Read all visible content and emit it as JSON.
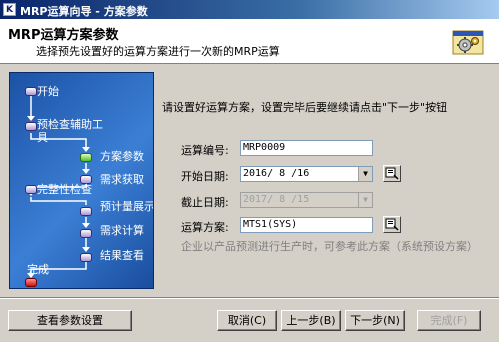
{
  "window": {
    "title": "MRP运算向导 - 方案参数",
    "icon": "app-logo-icon",
    "icon_text": "K"
  },
  "header": {
    "title": "MRP运算方案参数",
    "subtitle": "选择预先设置好的运算方案进行一次新的MRP运算",
    "icon": "gear-settings-icon"
  },
  "steps": [
    {
      "label": "开始",
      "state": "done"
    },
    {
      "label": "预检查辅助工具",
      "state": "done"
    },
    {
      "label": "方案参数",
      "state": "current"
    },
    {
      "label": "需求获取",
      "state": "pending"
    },
    {
      "label": "完整性检查",
      "state": "pending"
    },
    {
      "label": "预计量展示",
      "state": "pending"
    },
    {
      "label": "需求计算",
      "state": "pending"
    },
    {
      "label": "结果查看",
      "state": "pending"
    },
    {
      "label": "完成",
      "state": "end"
    }
  ],
  "form": {
    "instruction": "请设置好运算方案，设置完毕后要继续请点击\"下一步\"按钮",
    "calc_no": {
      "label": "运算编号:",
      "value": "MRP0009"
    },
    "start_date": {
      "label": "开始日期:",
      "value": "2016/ 8 /16"
    },
    "end_date": {
      "label": "截止日期:",
      "value": "2017/ 8 /15"
    },
    "plan": {
      "label": "运算方案:",
      "value": "MTS1(SYS)"
    },
    "hint": "企业以产品预测进行生产时，可参考此方案（系统预设方案）"
  },
  "buttons": {
    "view_params": "查看参数设置",
    "cancel": "取消(C)",
    "prev": "上一步(B)",
    "next": "下一步(N)",
    "finish": "完成(F)"
  }
}
